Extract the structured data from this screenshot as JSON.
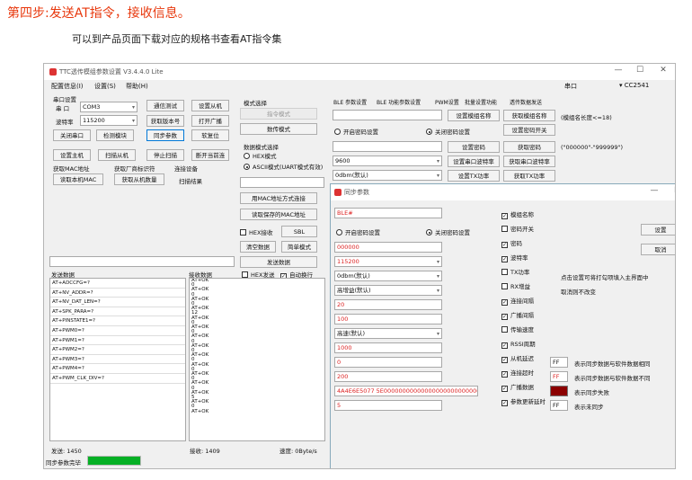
{
  "page": {
    "heading": "第四步:发送AT指令，接收信息。",
    "subheading": "可以到产品页面下载对应的规格书查看AT指令集"
  },
  "app": {
    "title": "TTC透传模组参数设置 V3.4.4.0 Lite",
    "controls": [
      "—",
      "☐",
      "✕"
    ],
    "menu": [
      "配置信息(I)",
      "设置(S)",
      "帮助(H)"
    ],
    "port_label": "串口",
    "port_value": "CC2541"
  },
  "serial": {
    "group": "串口设置",
    "port_label": "串 口",
    "port_value": "COM3",
    "baud_label": "波特率",
    "baud_value": "115200",
    "close": "关闭串口",
    "detect": "检测模块",
    "comm_test": "通信测试",
    "get_version": "获取版本号",
    "sync_params": "同步参数",
    "set_slave": "设置从机",
    "open_broadcast": "打开广播",
    "reset": "软复位",
    "set_master": "设置主机",
    "scan_slave": "扫描从机",
    "stop_scan": "停止扫描",
    "disconnect": "断开当前连"
  },
  "mac": {
    "get_mac": "获取MAC地址",
    "read_mac": "读取本机MAC",
    "get_vendor": "获取厂商标识符",
    "get_slave_count": "获取从机数量",
    "connect_device": "连接设备",
    "scan_result": "扫描结果"
  },
  "mode": {
    "title": "模式选择",
    "cmd_mode": "指令模式",
    "data_mode": "数传模式",
    "data_mode_sel": "数据模式选择",
    "hex_mode": "HEX模式",
    "ascii_mode": "ASCII模式(UART模式有效)",
    "connect_mac": "用MAC地址方式连接",
    "read_saved_mac": "读取保存的MAC地址",
    "hex_recv": "HEX接收",
    "sbl": "SBL",
    "clear": "清空数据",
    "simple_mode": "简单模式",
    "send": "发送数据",
    "hex_send": "HEX发送",
    "auto_newline": "自动换行"
  },
  "send_log": {
    "label": "发送数据",
    "lines": [
      "AT+ADCCFG=?",
      "AT+NV_ADDR=?",
      "AT+NV_DAT_LEN=?",
      "AT+SPK_PARA=?",
      "AT+PINSTATE1=?",
      "AT+PWM0=?",
      "AT+PWM1=?",
      "AT+PWM2=?",
      "AT+PWM3=?",
      "AT+PWM4=?",
      "AT+PWM_CLK_DIV=?"
    ]
  },
  "recv_log": {
    "label": "接收数据",
    "lines": [
      "AT+OK",
      "0",
      "AT+OK",
      "0",
      "AT+OK",
      "0",
      "AT+OK",
      "12",
      "AT+OK",
      "0",
      "AT+OK",
      "0",
      "AT+OK",
      "0",
      "AT+OK",
      "0",
      "AT+OK",
      "0",
      "AT+OK",
      "0",
      "AT+OK",
      "0",
      "AT+OK",
      "0",
      "AT+OK",
      "5",
      "AT+OK",
      "0",
      "AT+OK"
    ]
  },
  "status": {
    "send_count": "发送: 1450",
    "recv_count": "接收: 1409",
    "speed": "速度: 0Byte/s",
    "sync_done": "同步参数完毕",
    "progress": 1.0
  },
  "tabs": [
    "BLE 参数设置",
    "BLE 功能参数设置",
    "PWM设置",
    "批量设置功能",
    "透传数据发送"
  ],
  "ble": {
    "set_name": "设置模组名称",
    "get_name": "获取模组名称",
    "name_len": "(模组名长度<=18)",
    "open_pwd": "开启密码设置",
    "close_pwd": "关闭密码设置",
    "set_pwd_switch": "设置密码开关",
    "set_pwd": "设置密码",
    "get_pwd": "获取密码",
    "pwd_hint": "(\"000000\"-\"999999\")",
    "baud": "9600",
    "set_baud": "设置串口波特率",
    "get_baud": "获取串口波特率",
    "power": "0dbm(默认)",
    "set_power": "设置TX功率",
    "get_power": "获取TX功率"
  },
  "sync": {
    "title": "同步参数",
    "name": "BLE#",
    "open_pwd": "开启密码设置",
    "close_pwd": "关闭密码设置",
    "password": "000000",
    "baud": "115200",
    "tx_power": "0dbm(默认)",
    "rx_gain": "高增益(默认)",
    "conn_interval": "20",
    "adv_interval": "100",
    "speed": "高速(默认)",
    "rssi_period": "1000",
    "slave_delay": "0",
    "conn_timeout": "200",
    "adv_data": "4A4E6E5077 5E000000000000000000000000000000",
    "update_interval": "5",
    "checks": [
      "模组名称",
      "密码开关",
      "密码",
      "波特率",
      "TX功率",
      "RX增益",
      "连接间隔",
      "广播间隔",
      "传输速度",
      "RSSI周期",
      "从机延迟",
      "连接超时",
      "广播数据",
      "参数更新延时"
    ],
    "checked": [
      true,
      false,
      true,
      true,
      false,
      false,
      true,
      true,
      false,
      true,
      true,
      true,
      true,
      true
    ],
    "set": "设置",
    "cancel": "取消",
    "hint1": "点击设置可将打勾项填入主界面中",
    "hint2": "取消则不改变",
    "ff": "FF",
    "legend": [
      "表示同步数据与软件数据相同",
      "表示同步数据与软件数据不同",
      "表示同步失败",
      "表示未同步"
    ],
    "colors": {
      "same": "#ffffff",
      "diff": "#ffffff",
      "fail": "#8b0000",
      "none": "#ffffff"
    }
  }
}
